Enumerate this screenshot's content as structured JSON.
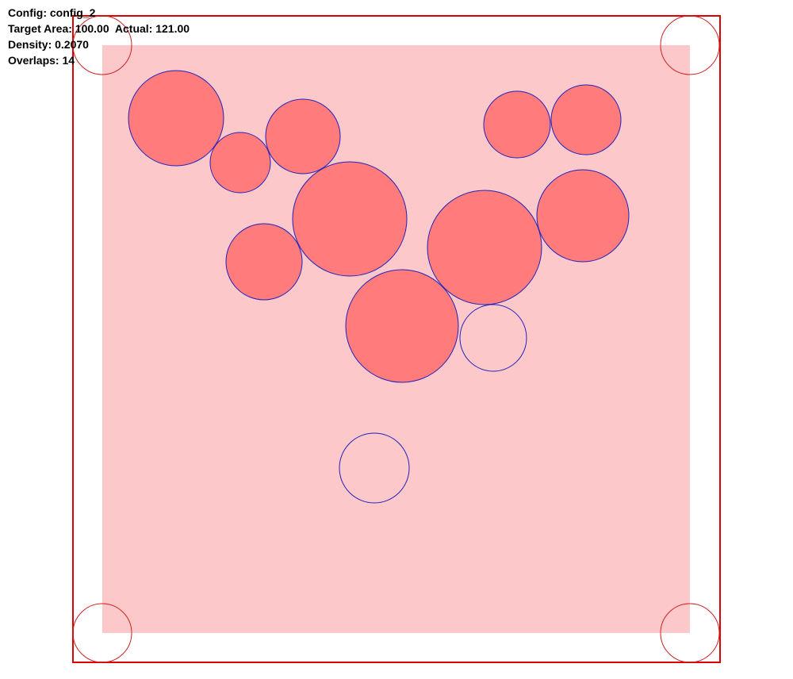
{
  "info": {
    "config_line": "Config: config_2",
    "area_line": "Target Area: 100.00  Actual: 121.00",
    "density_line": "Density: 0.2070",
    "overlaps_line": "Overlaps: 14"
  },
  "colors": {
    "background": "#ffffff",
    "frame": "#dd0000",
    "shaded_region": "#fcc8ca",
    "filled_circle": "#ff7b7c",
    "circle_outline": "#2222bb",
    "corner_circle": "#cc2222"
  },
  "circles": [
    {
      "name": "circle-1",
      "filled": true
    },
    {
      "name": "circle-2",
      "filled": true
    },
    {
      "name": "circle-3",
      "filled": true
    },
    {
      "name": "circle-4",
      "filled": true
    },
    {
      "name": "circle-5",
      "filled": true
    },
    {
      "name": "circle-6",
      "filled": true
    },
    {
      "name": "circle-7",
      "filled": true
    },
    {
      "name": "circle-8",
      "filled": true
    },
    {
      "name": "circle-9",
      "filled": true
    },
    {
      "name": "circle-10",
      "filled": true
    },
    {
      "name": "circle-11",
      "filled": false
    },
    {
      "name": "circle-12",
      "filled": false
    }
  ]
}
